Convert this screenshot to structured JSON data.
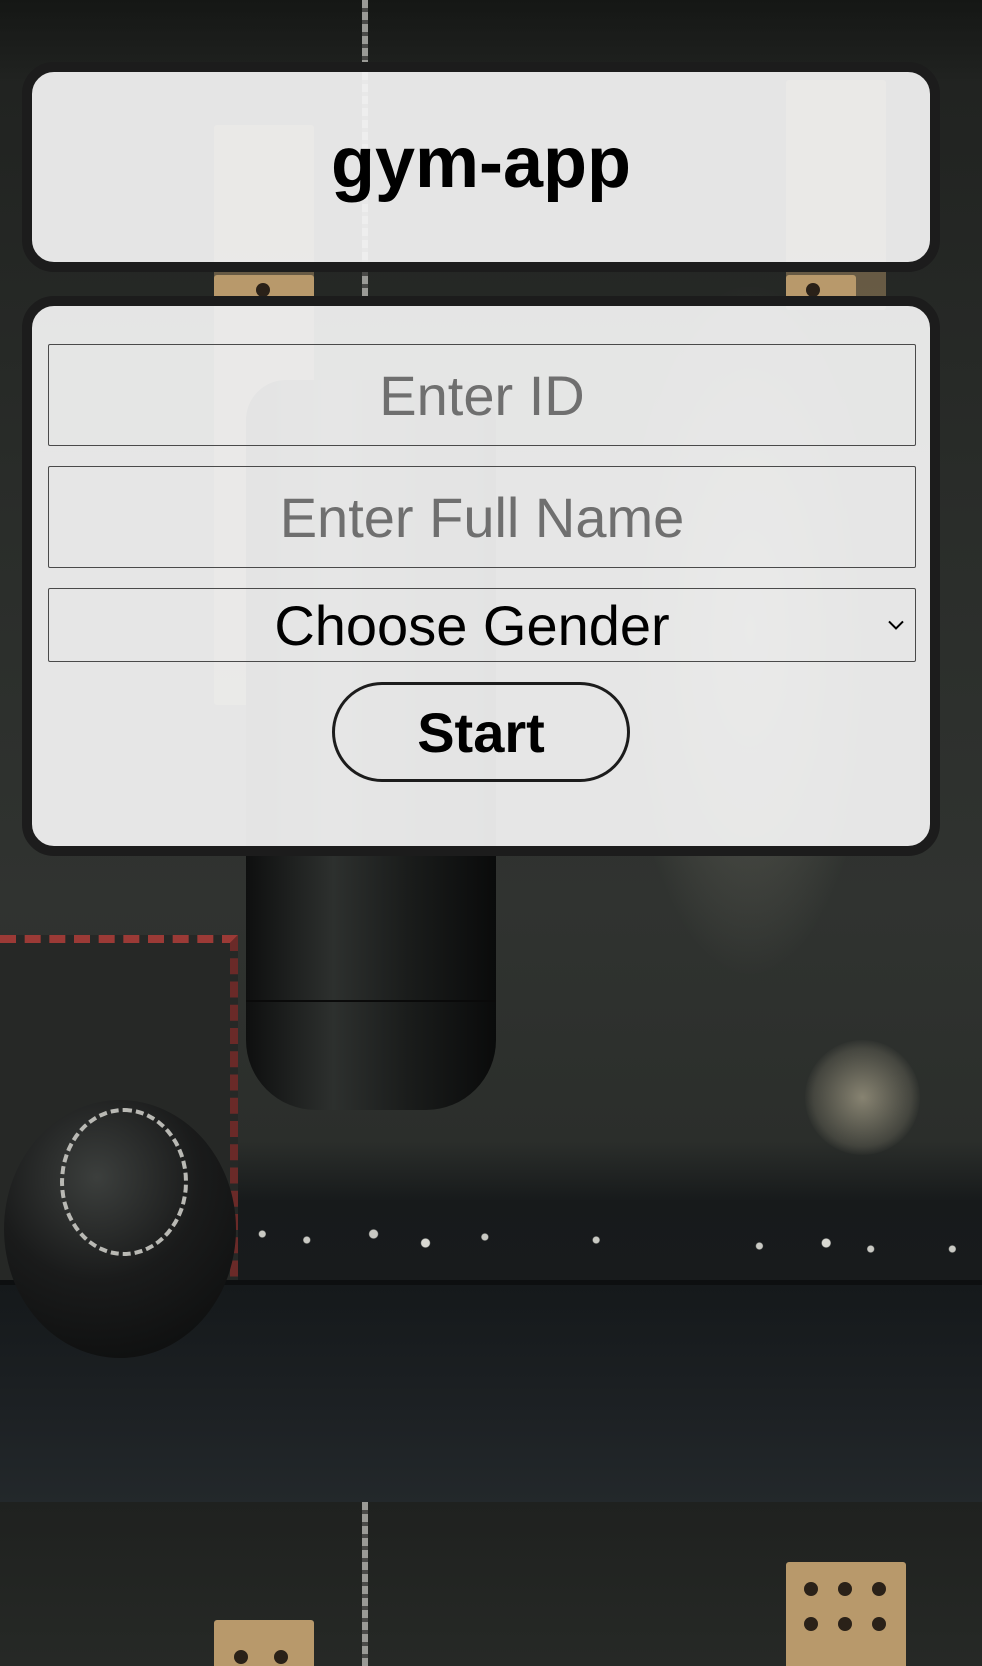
{
  "header": {
    "title": "gym-app"
  },
  "form": {
    "id_placeholder": "Enter ID",
    "id_value": "",
    "name_placeholder": "Enter Full Name",
    "name_value": "",
    "gender_select": {
      "selected": "Choose Gender",
      "icon": "chevron-down-icon"
    },
    "start_label": "Start"
  },
  "colors": {
    "card_background": "#f4f4f4",
    "card_border": "#1c1c1c",
    "placeholder_text": "#6f6f6f",
    "text": "#000000"
  }
}
